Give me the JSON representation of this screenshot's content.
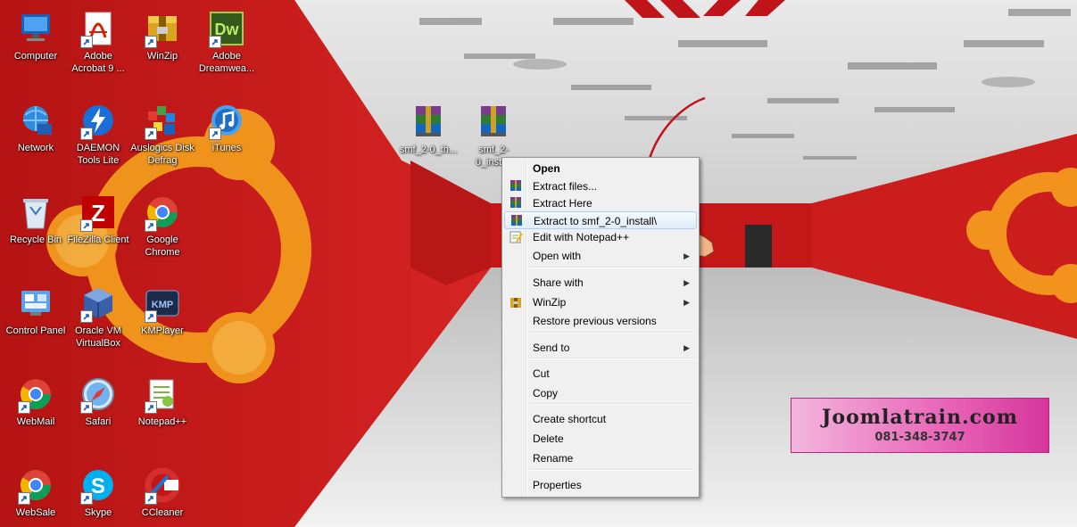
{
  "desktop": {
    "icons": [
      {
        "label": "Computer"
      },
      {
        "label": "Adobe Acrobat 9 ..."
      },
      {
        "label": "WinZip"
      },
      {
        "label": "Adobe Dreamwea..."
      },
      {
        "label": "Network"
      },
      {
        "label": "DAEMON Tools Lite"
      },
      {
        "label": "Auslogics Disk Defrag"
      },
      {
        "label": "iTunes"
      },
      {
        "label": "Recycle Bin"
      },
      {
        "label": "FileZilla Client"
      },
      {
        "label": "Google Chrome"
      },
      {
        "label": "Control Panel"
      },
      {
        "label": "Oracle VM VirtualBox"
      },
      {
        "label": "KMPlayer"
      },
      {
        "label": "WebMail"
      },
      {
        "label": "Safari"
      },
      {
        "label": "Notepad++"
      },
      {
        "label": "WebSale"
      },
      {
        "label": "Skype"
      },
      {
        "label": "CCleaner"
      }
    ],
    "files": [
      {
        "label": "smf_2-0_th..."
      },
      {
        "label": "smf_2-0_install"
      }
    ],
    "dw_badge": "Dw",
    "kmp_badge": "KMP"
  },
  "context_menu": {
    "items": [
      {
        "label": "Open"
      },
      {
        "label": "Extract files..."
      },
      {
        "label": "Extract Here"
      },
      {
        "label": "Extract to smf_2-0_install\\"
      },
      {
        "label": "Edit with Notepad++"
      },
      {
        "label": "Open with"
      },
      {
        "label": "Share with"
      },
      {
        "label": "WinZip"
      },
      {
        "label": "Restore previous versions"
      },
      {
        "label": "Send to"
      },
      {
        "label": "Cut"
      },
      {
        "label": "Copy"
      },
      {
        "label": "Create shortcut"
      },
      {
        "label": "Delete"
      },
      {
        "label": "Rename"
      },
      {
        "label": "Properties"
      }
    ]
  },
  "promo": {
    "site": "Joomlatrain.com",
    "phone": "081-348-3747"
  },
  "colors": {
    "wall_red": "#c91c1c",
    "floor": "#dcdcdc",
    "ubuntu_orange": "#f39a1d",
    "menu_bg": "#f0f0f0",
    "menu_hover": "#e0ecfa",
    "annotation_arrow": "#c0141b"
  }
}
